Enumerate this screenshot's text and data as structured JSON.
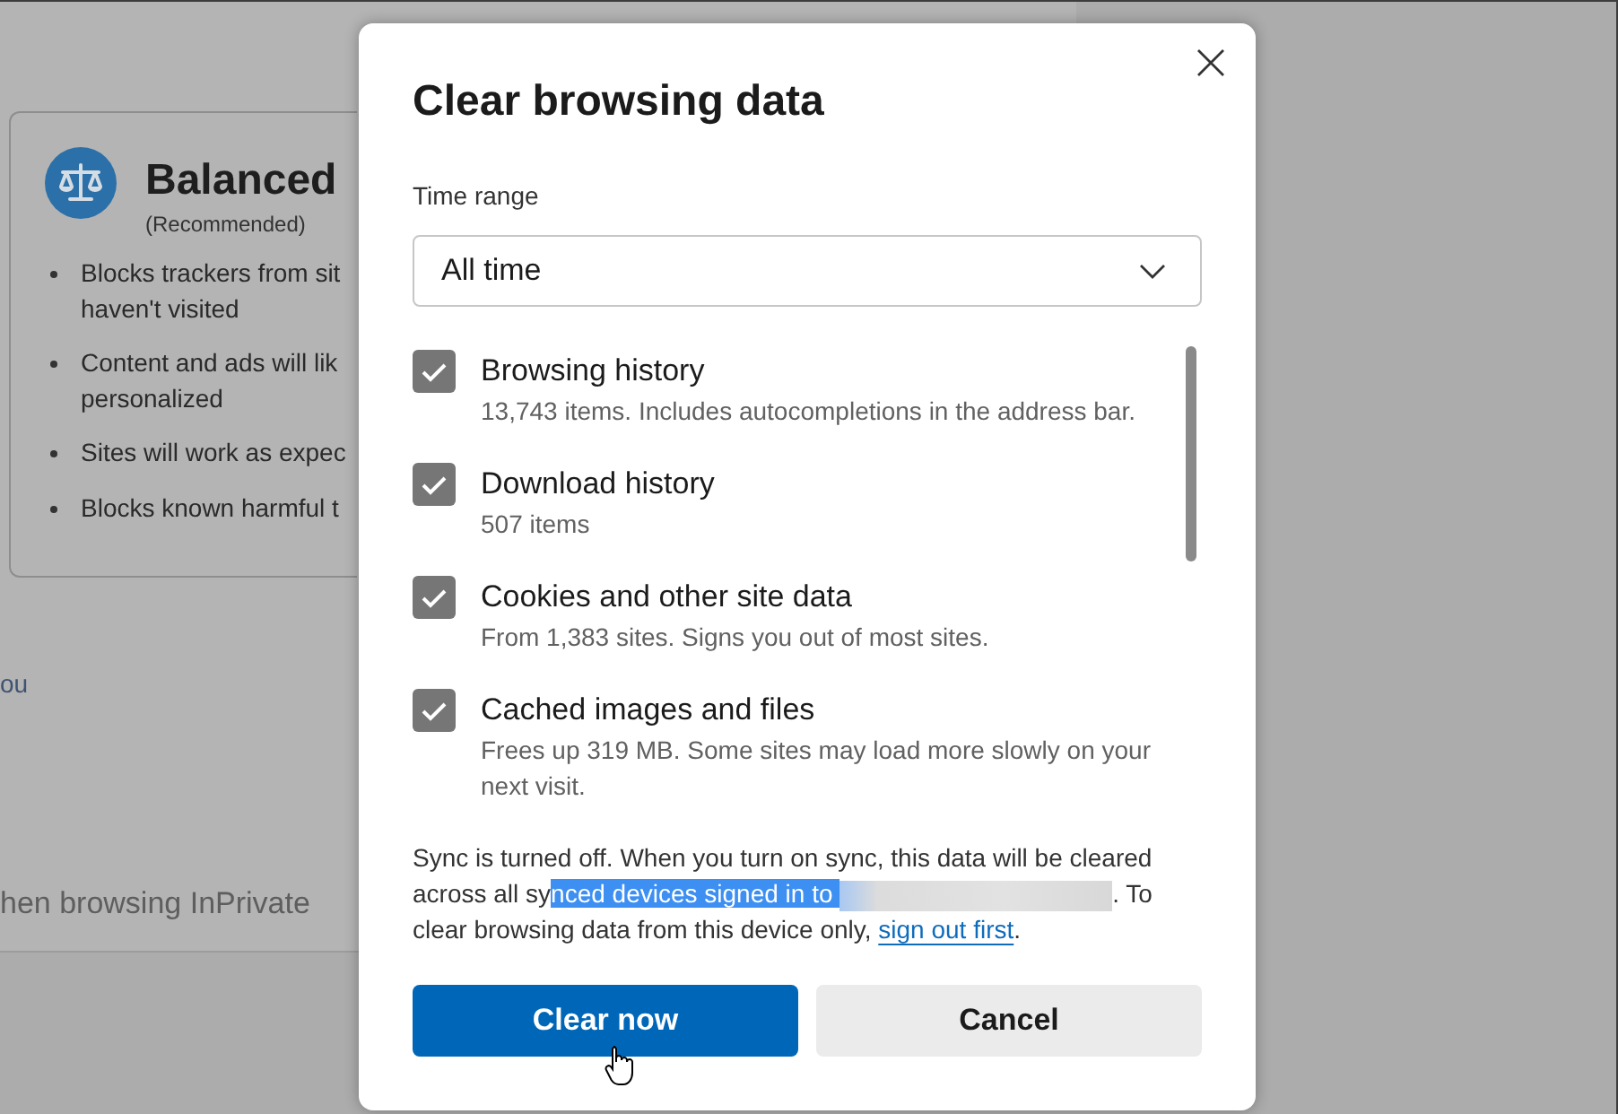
{
  "page": {
    "protection_card": {
      "title": "Balanced",
      "subtitle": "(Recommended)",
      "bullets": [
        {
          "lines": [
            "Blocks trackers from sit",
            "haven't visited"
          ]
        },
        {
          "lines": [
            "Content and ads will lik",
            "personalized"
          ]
        },
        {
          "lines": [
            "Sites will work as expec"
          ]
        },
        {
          "lines": [
            "Blocks known harmful t"
          ]
        }
      ]
    },
    "text_fragment": "ou",
    "section_heading": "hen browsing InPrivate"
  },
  "dialog": {
    "title": "Clear browsing data",
    "time_range": {
      "label": "Time range",
      "value": "All time"
    },
    "items": [
      {
        "title": "Browsing history",
        "description": "13,743 items. Includes autocompletions in the address bar.",
        "checked": true
      },
      {
        "title": "Download history",
        "description": "507 items",
        "checked": true
      },
      {
        "title": "Cookies and other site data",
        "description": "From 1,383 sites. Signs you out of most sites.",
        "checked": true
      },
      {
        "title": "Cached images and files",
        "description": "Frees up 319 MB. Some sites may load more slowly on your next visit.",
        "checked": true
      }
    ],
    "sync_notice": [
      {
        "kind": "text",
        "text": "Sync is turned off. When you turn on sync, this data will be cleared across all sy"
      },
      {
        "kind": "highlighted",
        "text": "nced devices signed in to "
      },
      {
        "kind": "redacted"
      },
      {
        "kind": "text",
        "text": ". To clear browsing data from this device only, "
      },
      {
        "kind": "link",
        "text": "sign out first"
      },
      {
        "kind": "text",
        "text": "."
      }
    ],
    "buttons": [
      {
        "label": "Clear now",
        "kind": "primary",
        "hovered": true
      },
      {
        "label": "Cancel",
        "kind": "secondary",
        "hovered": false
      }
    ]
  }
}
